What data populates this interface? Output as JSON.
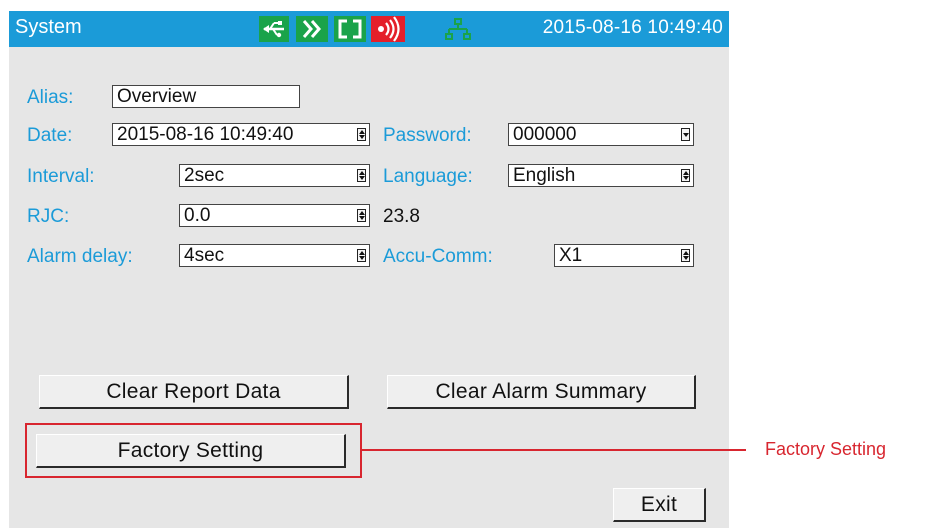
{
  "titlebar": {
    "title": "System",
    "datetime": "2015-08-16 10:49:40",
    "status_icons": [
      "usb-icon",
      "run-icon",
      "cycle-icon",
      "alarm-icon",
      "network-icon"
    ]
  },
  "form": {
    "alias": {
      "label": "Alias:",
      "value": "Overview"
    },
    "date": {
      "label": "Date:",
      "value": "2015-08-16 10:49:40"
    },
    "password": {
      "label": "Password:",
      "value": "000000"
    },
    "interval": {
      "label": "Interval:",
      "value": "2sec"
    },
    "language": {
      "label": "Language:",
      "value": "English"
    },
    "rjc": {
      "label": "RJC:",
      "value": "0.0",
      "reading": "23.8"
    },
    "alarm_delay": {
      "label": "Alarm delay:",
      "value": "4sec"
    },
    "accu_comm": {
      "label": "Accu-Comm:",
      "value": "X1"
    }
  },
  "buttons": {
    "clear_report": "Clear Report Data",
    "clear_alarm": "Clear Alarm Summary",
    "factory_setting": "Factory Setting",
    "exit": "Exit"
  },
  "callout": {
    "label": "Factory Setting"
  },
  "colors": {
    "titlebar": "#1b9bd8",
    "label": "#1b9bd8",
    "icon_green": "#1aa34a",
    "icon_red": "#e41f2a",
    "screen_bg": "#e6e6e6",
    "callout": "#d8262f"
  }
}
